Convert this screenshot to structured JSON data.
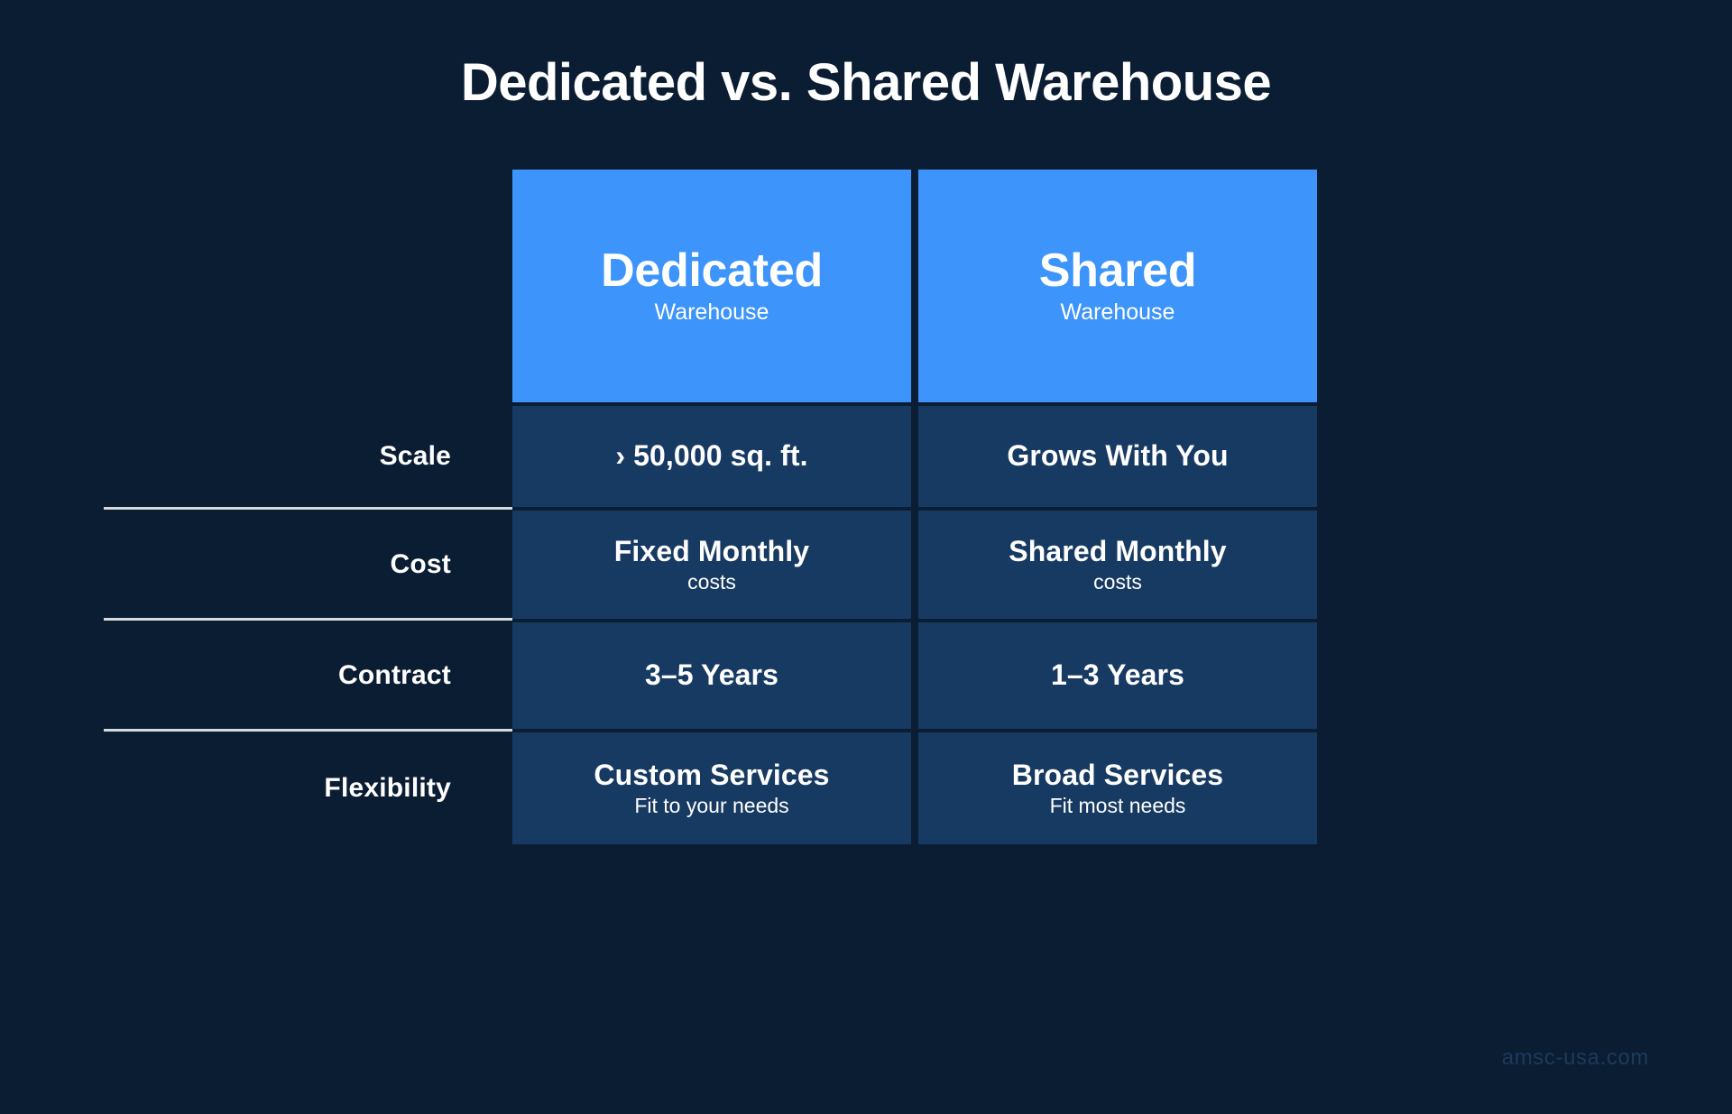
{
  "title": "Dedicated vs. Shared Warehouse",
  "colors": {
    "background": "#0b1d33",
    "header_blue": "#3d94fb",
    "cell_navy": "#173a62",
    "text_white": "#ffffff",
    "divider": "#d6dbe0",
    "watermark": "#1d3a5c"
  },
  "columns": [
    {
      "title": "Dedicated",
      "subtitle": "Warehouse"
    },
    {
      "title": "Shared",
      "subtitle": "Warehouse"
    }
  ],
  "rows": [
    {
      "label": "Scale",
      "cells": [
        {
          "main": "› 50,000 sq. ft.",
          "sub": ""
        },
        {
          "main": "Grows With You",
          "sub": ""
        }
      ]
    },
    {
      "label": "Cost",
      "cells": [
        {
          "main": "Fixed Monthly",
          "sub": "costs"
        },
        {
          "main": "Shared Monthly",
          "sub": "costs"
        }
      ]
    },
    {
      "label": "Contract",
      "cells": [
        {
          "main": "3–5 Years",
          "sub": ""
        },
        {
          "main": "1–3 Years",
          "sub": ""
        }
      ]
    },
    {
      "label": "Flexibility",
      "cells": [
        {
          "main": "Custom Services",
          "sub": "Fit to your needs"
        },
        {
          "main": "Broad Services",
          "sub": "Fit most needs"
        }
      ]
    }
  ],
  "watermark": "amsc-usa.com"
}
